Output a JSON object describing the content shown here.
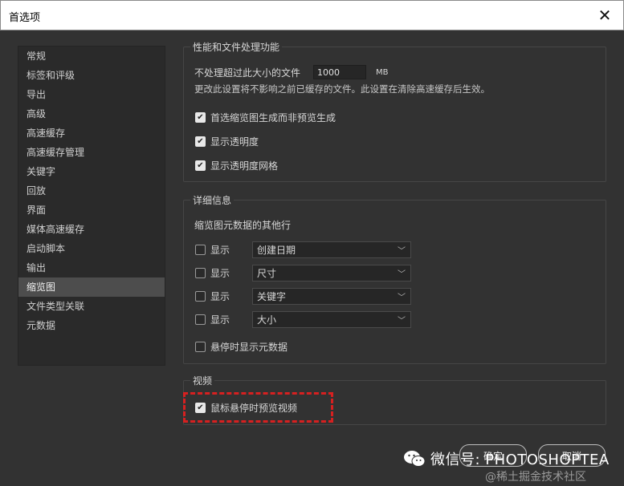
{
  "window": {
    "title": "首选项",
    "close_glyph": "✕"
  },
  "sidebar": {
    "items": [
      {
        "label": "常规"
      },
      {
        "label": "标签和评级"
      },
      {
        "label": "导出"
      },
      {
        "label": "高级"
      },
      {
        "label": "高速缓存"
      },
      {
        "label": "高速缓存管理"
      },
      {
        "label": "关键字"
      },
      {
        "label": "回放"
      },
      {
        "label": "界面"
      },
      {
        "label": "媒体高速缓存"
      },
      {
        "label": "启动脚本"
      },
      {
        "label": "输出"
      },
      {
        "label": "缩览图",
        "active": true
      },
      {
        "label": "文件类型关联"
      },
      {
        "label": "元数据"
      }
    ]
  },
  "performance": {
    "legend": "性能和文件处理功能",
    "size_label": "不处理超过此大小的文件",
    "size_value": "1000",
    "size_unit": "MB",
    "note": "更改此设置将不影响之前已缓存的文件。此设置在清除高速缓存后生效。",
    "options": [
      {
        "label": "首选缩览图生成而非预览生成",
        "checked": true
      },
      {
        "label": "显示透明度",
        "checked": true
      },
      {
        "label": "显示透明度网格",
        "checked": true
      }
    ]
  },
  "details": {
    "legend": "详细信息",
    "subtitle": "缩览图元数据的其他行",
    "rows": [
      {
        "show_label": "显示",
        "checked": false,
        "value": "创建日期"
      },
      {
        "show_label": "显示",
        "checked": false,
        "value": "尺寸"
      },
      {
        "show_label": "显示",
        "checked": false,
        "value": "关键字"
      },
      {
        "show_label": "显示",
        "checked": false,
        "value": "大小"
      }
    ],
    "hover_option": {
      "label": "悬停时显示元数据",
      "checked": false
    }
  },
  "video": {
    "legend": "视频",
    "option": {
      "label": "鼠标悬停时预览视频",
      "checked": true
    }
  },
  "buttons": {
    "ok": "确定",
    "cancel": "取消"
  },
  "watermark": {
    "main": "微信号: PHOTOSHOPTEA",
    "sub": "@稀土掘金技术社区"
  },
  "colors": {
    "background": "#323232",
    "highlight": "#d62020"
  }
}
